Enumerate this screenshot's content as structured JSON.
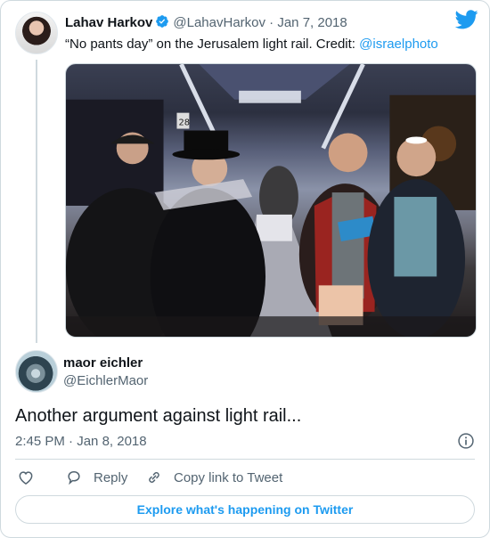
{
  "parent_tweet": {
    "author_name": "Lahav Harkov",
    "author_handle": "@LahavHarkov",
    "dot": "·",
    "date": "Jan 7, 2018",
    "text_before": "“No pants day” on the Jerusalem light rail. Credit: ",
    "mention": "@israelphoto",
    "photo_sign": "28"
  },
  "tweet": {
    "author_name": "maor eichler",
    "author_handle": "@EichlerMaor",
    "text": "Another argument against light rail...",
    "time": "2:45 PM",
    "dot": "·",
    "date": "Jan 8, 2018"
  },
  "actions": {
    "reply_label": "Reply",
    "copy_label": "Copy link to Tweet"
  },
  "explore_label": "Explore what's happening on Twitter",
  "colors": {
    "accent": "#1d9bf0",
    "text": "#0f1419",
    "secondary": "#536471",
    "border": "#cfd9de"
  }
}
